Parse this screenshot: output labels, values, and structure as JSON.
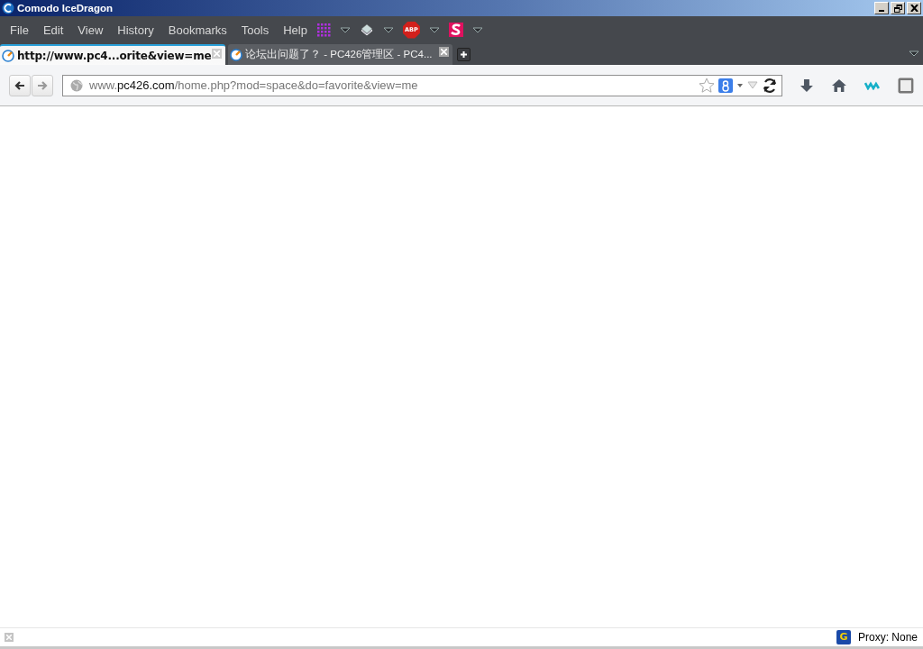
{
  "window": {
    "title": "Comodo IceDragon"
  },
  "adblock_badge": "ABP",
  "menu": [
    "File",
    "Edit",
    "View",
    "History",
    "Bookmarks",
    "Tools",
    "Help"
  ],
  "tabs": [
    {
      "title": "http://www.pc4...orite&view=me",
      "selected": true
    },
    {
      "title": "论坛出问题了？ - PC426管理区 - PC4...",
      "selected": false
    }
  ],
  "address_bar": {
    "url": "www.**pc426.com**/home.php?mod=space&do=favorite&view=me"
  },
  "status_bar": {
    "proxy_badge": "G",
    "proxy": "Proxy: None"
  }
}
